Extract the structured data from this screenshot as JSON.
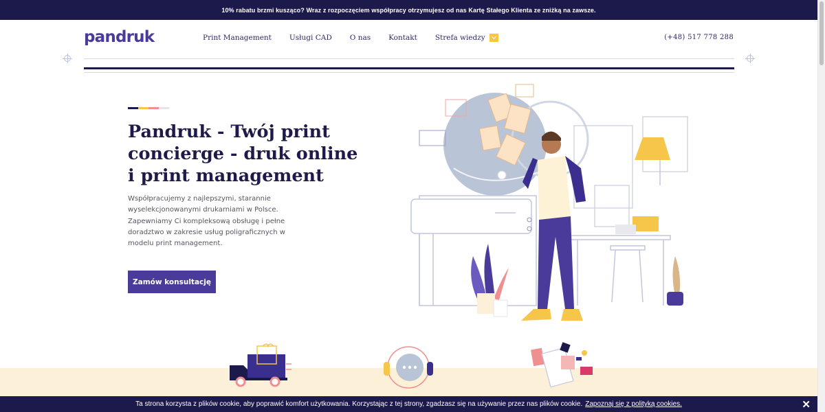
{
  "promo_bar": {
    "text": "10% rabatu brzmi kusząco? Wraz z rozpoczęciem współpracy otrzymujesz od nas Kartę Stałego Klienta ze zniżką na zawsze."
  },
  "header": {
    "logo": "pandruk",
    "nav": [
      {
        "label": "Print Management"
      },
      {
        "label": "Usługi CAD"
      },
      {
        "label": "O nas"
      },
      {
        "label": "Kontakt"
      },
      {
        "label": "Strefa wiedzy"
      }
    ],
    "phone": "(+48) 517 778 288"
  },
  "hero": {
    "title": "Pandruk - Twój print concierge - druk online i print management",
    "description": "Współpracujemy z najlepszymi, starannie wyselekcjonowanymi drukarniami w Polsce. Zapewniamy Ci kompleksową obsługę i pełne doradztwo w zakresie usług poligraficznych w modelu print management.",
    "cta": "Zamów konsultację"
  },
  "cookie_bar": {
    "text": "Ta strona korzysta z plików cookie, aby poprawić komfort użytkowania. Korzystając z tej strony, zgadzasz się na używanie przez nas plików cookie.",
    "link": "Zapoznaj się z polityką cookies.",
    "close": "✕"
  },
  "colors": {
    "navy": "#1c1a4b",
    "brand_purple": "#4a3a9a",
    "accent_yellow": "#f5c64a",
    "accent_pink": "#f08f8f",
    "band_cream": "#fdf0d8"
  },
  "icons": [
    "chevron-down-icon",
    "crosshair-icon",
    "delivery-truck-icon",
    "headset-chat-icon",
    "print-samples-icon",
    "close-icon"
  ]
}
